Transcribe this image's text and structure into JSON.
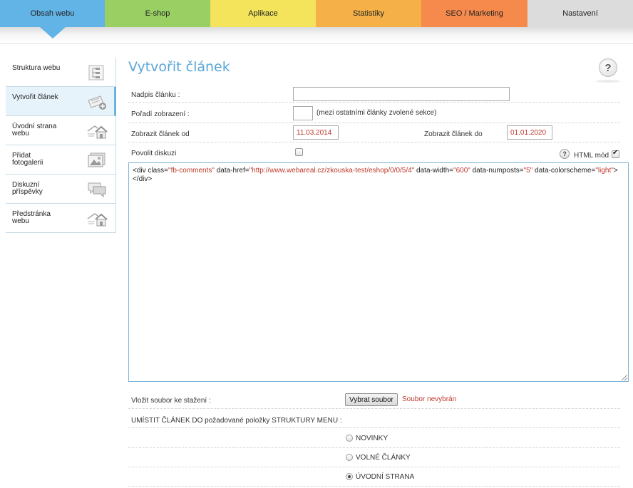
{
  "topnav": {
    "tabs": [
      {
        "label": "Obsah webu",
        "color": "#62b3e6",
        "active": true
      },
      {
        "label": "E-shop",
        "color": "#9ad063"
      },
      {
        "label": "Aplikace",
        "color": "#f3e45c"
      },
      {
        "label": "Statistiky",
        "color": "#f5b148"
      },
      {
        "label": "SEO / Marketing",
        "color": "#f58a4c"
      },
      {
        "label": "Nastavení",
        "color": "#dcdcdc"
      }
    ]
  },
  "sidebar": {
    "items": [
      {
        "label": "Struktura webu",
        "icon": "sitemap-icon"
      },
      {
        "label": "Vytvořit článek",
        "icon": "add-document-icon",
        "active": true
      },
      {
        "label": "Úvodní strana webu",
        "icon": "home-icon"
      },
      {
        "label": "Přidat fotogalerii",
        "icon": "gallery-icon"
      },
      {
        "label": "Diskuzní příspěvky",
        "icon": "chat-icon"
      },
      {
        "label": "Předstránka webu",
        "icon": "home-icon"
      }
    ]
  },
  "main": {
    "title": "Vytvořit článek",
    "help_symbol": "?",
    "form": {
      "heading_label": "Nadpis článku :",
      "heading_value": "",
      "order_label": "Pořadí zobrazení :",
      "order_value": "",
      "order_note": "(mezi ostatními články zvolené sekce)",
      "date_from_label": "Zobrazit článek od",
      "date_from_value": "11.03.2014",
      "date_to_label": "Zobrazit článek do",
      "date_to_value": "01.01.2020",
      "discussion_label": "Povolit diskuzi",
      "discussion_checked": false,
      "html_mode_label": "HTML mód",
      "html_mode_checked": true,
      "editor": {
        "t1": "<div class=",
        "v1": "\"fb-comments\"",
        "t2": " data-href=",
        "v2": "\"http://www.webareal.cz/zkouska-test/eshop/0/0/5/4\"",
        "t3": " data-width=",
        "v3": "\"600\"",
        "t4": " data-numposts=",
        "v4": "\"5\"",
        "t5": " data-colorscheme=",
        "v5": "\"light\"",
        "t6": "></div>"
      },
      "file_label": "Vložit soubor ke stažení :",
      "file_button": "Vybrat soubor",
      "file_status": "Soubor nevybrán",
      "menu_label": "UMÍSTIT ČLÁNEK DO požadované položky STRUKTURY MENU :",
      "menu_options": [
        {
          "label": "NOVINKY",
          "checked": false
        },
        {
          "label": "VOLNÉ ČLÁNKY",
          "checked": false
        },
        {
          "label": "ÚVODNÍ STRANA",
          "checked": true
        }
      ]
    }
  }
}
